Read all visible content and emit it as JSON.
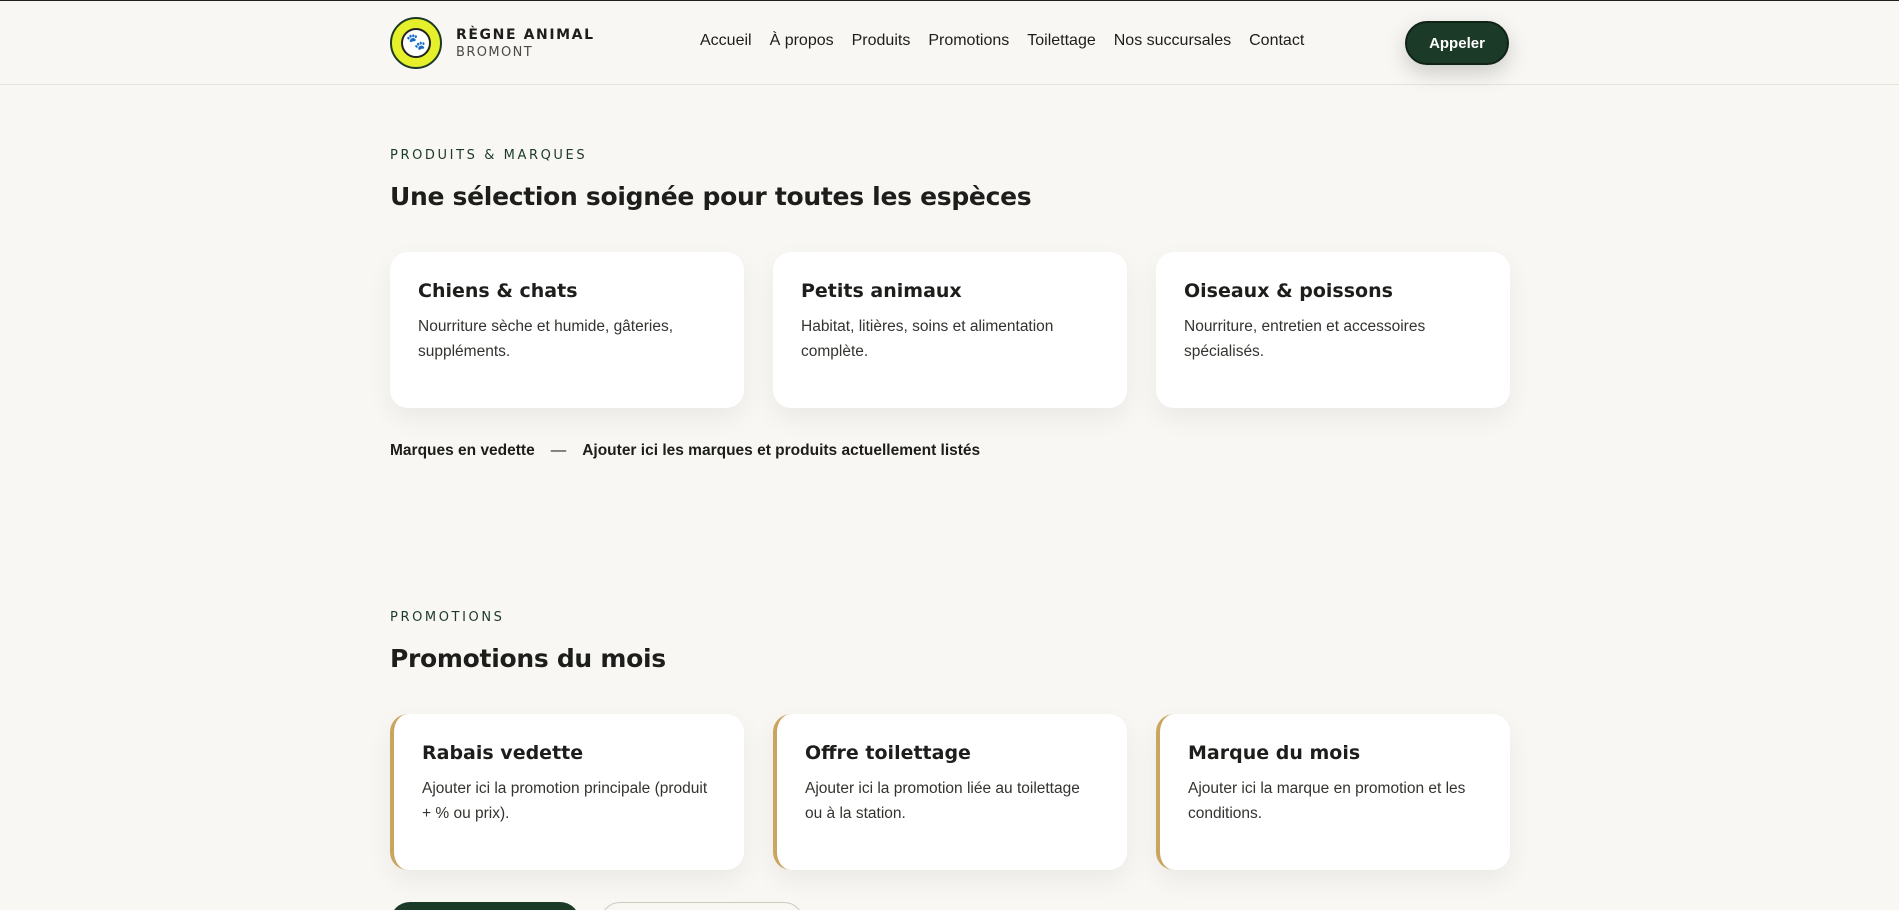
{
  "brand": {
    "name": "RÈGNE ANIMAL",
    "city": "BROMONT",
    "logo_icon": "paw-logo-icon"
  },
  "nav": {
    "items": [
      "Accueil",
      "À propos",
      "Produits",
      "Promotions",
      "Toilettage",
      "Nos succursales",
      "Contact"
    ]
  },
  "header": {
    "call_label": "Appeler"
  },
  "products": {
    "eyebrow": "PRODUITS & MARQUES",
    "title": "Une sélection soignée pour toutes les espèces",
    "cards": [
      {
        "title": "Chiens & chats",
        "text": "Nourriture sèche et humide, gâteries, suppléments."
      },
      {
        "title": "Petits animaux",
        "text": "Habitat, litières, soins et alimentation complète."
      },
      {
        "title": "Oiseaux & poissons",
        "text": "Nourriture, entretien et accessoires spécialisés."
      }
    ],
    "featured_label": "Marques en vedette",
    "featured_separator": "—",
    "featured_text": "Ajouter ici les marques et produits actuellement listés"
  },
  "promotions": {
    "eyebrow": "PROMOTIONS",
    "title": "Promotions du mois",
    "cards": [
      {
        "title": "Rabais vedette",
        "text": "Ajouter ici la promotion principale (produit + % ou prix)."
      },
      {
        "title": "Offre toilettage",
        "text": "Ajouter ici la promotion liée au toilettage ou à la station."
      },
      {
        "title": "Marque du mois",
        "text": "Ajouter ici la marque en promotion et les conditions."
      }
    ]
  },
  "colors": {
    "background": "#f8f7f3",
    "primary_green": "#1c3a28",
    "accent_gold": "#c9a560",
    "logo_yellow": "#e5ef2a"
  }
}
